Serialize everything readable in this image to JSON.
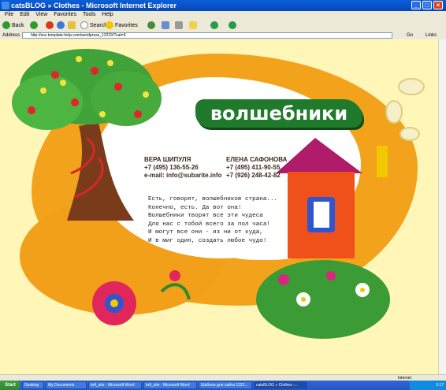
{
  "window": {
    "title": "catsBLOG » Clothes - Microsoft Internet Explorer",
    "controls": [
      "_",
      "□",
      "×"
    ]
  },
  "menu": [
    "File",
    "Edit",
    "View",
    "Favorites",
    "Tools",
    "Help"
  ],
  "toolbar": {
    "back": "Back",
    "search": "Search",
    "favorites": "Favorites"
  },
  "address": {
    "label": "Address",
    "url": "http://osc.template-help.com/wordpress_12223/?cat=9",
    "go": "Go",
    "links": "Links"
  },
  "page": {
    "heading": "волшебники",
    "contact1": {
      "name": "ВЕРА ШИПУЛЯ",
      "phone": "+7 (495) 136-55-26",
      "email": "e-mail: info@subarite.info"
    },
    "contact2": {
      "name": "ЕЛЕНА САФОНОВА",
      "phone1": "+7 (495) 411-90-55,",
      "phone2": "+7 (926) 248-42-82"
    },
    "poem": [
      "Есть, говорят, волшебников страна...",
      "Конечно, есть. Да вот она!",
      "Волшебники творят все эти чудеса",
      "Для нас с тобой всего за пол часа!",
      "И могут все они - из ни от куда,",
      "И в миг один, создать любое чудо!"
    ]
  },
  "status": {
    "zone": "Internet"
  },
  "taskbar": {
    "start": "Start",
    "tasks": [
      "Desktop",
      "My Documents",
      "brif_site - Microsoft Word",
      "brif_site - Microsoft Word",
      "Шаблон для сайта 1222...",
      "catsBLOG » Clothes -..."
    ],
    "clock": "2:17"
  },
  "colors": {
    "accent": "#1f7a2c",
    "orange": "#f3a21b",
    "background": "#fff6b8"
  }
}
